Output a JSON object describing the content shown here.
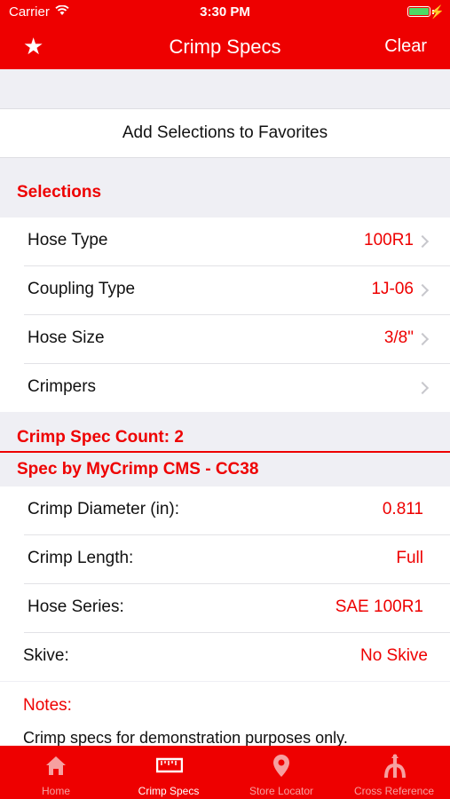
{
  "status": {
    "carrier": "Carrier",
    "time": "3:30 PM"
  },
  "nav": {
    "title": "Crimp Specs",
    "clear_label": "Clear",
    "favorite_icon": "star-icon"
  },
  "favorites_label": "Add Selections to Favorites",
  "selections": {
    "header": "Selections",
    "rows": [
      {
        "label": "Hose Type",
        "value": "100R1"
      },
      {
        "label": "Coupling Type",
        "value": "1J-06"
      },
      {
        "label": "Hose Size",
        "value": "3/8\""
      },
      {
        "label": "Crimpers",
        "value": ""
      }
    ]
  },
  "count_header": "Crimp Spec Count: 2",
  "spec": {
    "header": "Spec by MyCrimp  CMS - CC38",
    "rows": [
      {
        "label": "Crimp Diameter (in):",
        "value": "0.811"
      },
      {
        "label": "Crimp Length:",
        "value": "Full"
      },
      {
        "label": "Hose Series:",
        "value": "SAE 100R1"
      },
      {
        "label": "Skive:",
        "value": "No Skive"
      }
    ]
  },
  "notes": {
    "title": "Notes:",
    "text": "Crimp specs for demonstration purposes only."
  },
  "tabs": [
    {
      "label": "Home",
      "icon": "home-icon",
      "active": false
    },
    {
      "label": "Crimp Specs",
      "icon": "ruler-icon",
      "active": true
    },
    {
      "label": "Store Locator",
      "icon": "location-pin-icon",
      "active": false
    },
    {
      "label": "Cross Reference",
      "icon": "branch-icon",
      "active": false
    }
  ],
  "colors": {
    "accent": "#ee0000",
    "background": "#efeff4",
    "inactive_tab": "#f6a0a0"
  }
}
